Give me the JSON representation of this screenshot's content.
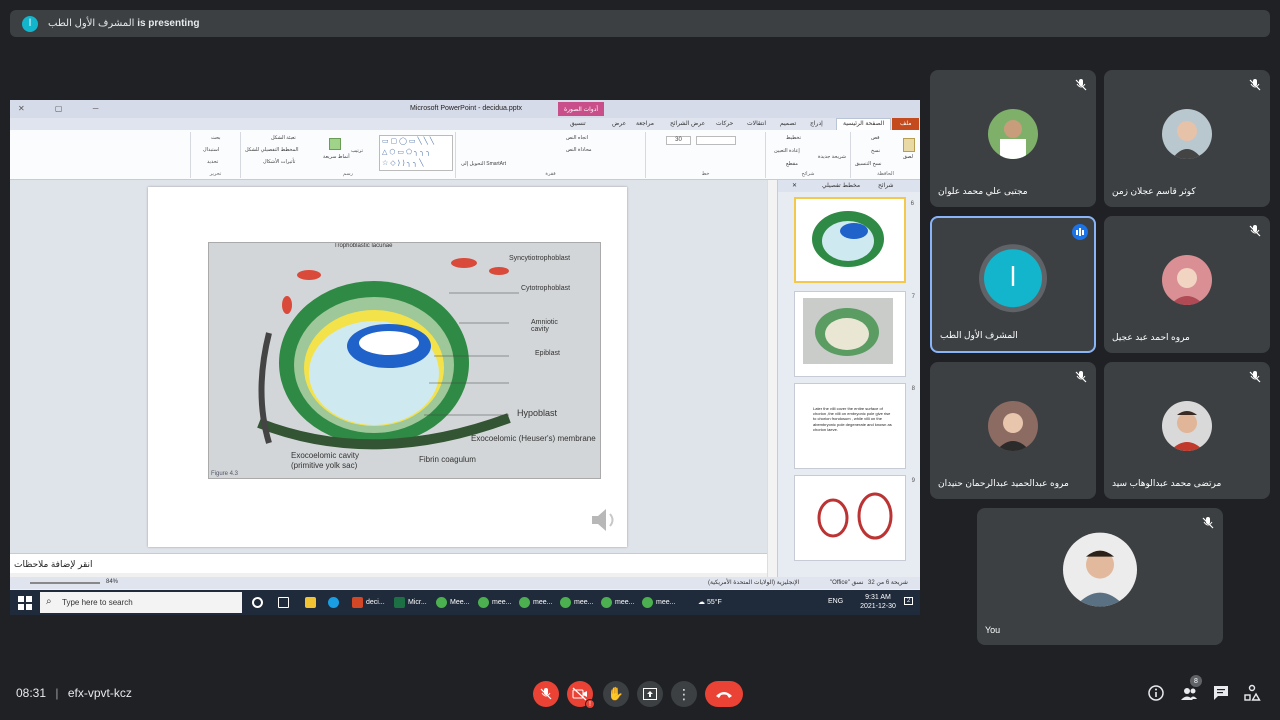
{
  "meet": {
    "presenter_name": "المشرف الأول الطب",
    "presenting_suffix": "is presenting",
    "presenter_initial": "ا",
    "time": "08:31",
    "separator": "|",
    "meeting_code": "efx-vpvt-kcz",
    "participant_badge": "8",
    "participants": [
      {
        "name": "مجتبى علي محمد علوان",
        "muted": true
      },
      {
        "name": "كوثر قاسم عجلان زمن",
        "muted": true
      },
      {
        "name": "المشرف الأول الطب",
        "muted": false,
        "speaking": true,
        "initial": "ا"
      },
      {
        "name": "مروه احمد عبد عجيل",
        "muted": true
      },
      {
        "name": "مروه عبدالحميد عبدالرحمان حنيدان",
        "muted": true
      },
      {
        "name": "مرتضى محمد عبدالوهاب سيد",
        "muted": true
      },
      {
        "name": "You",
        "muted": true
      }
    ],
    "accent": "#1a73e8",
    "danger": "#ea4335"
  },
  "powerpoint": {
    "window_title": "Microsoft PowerPoint - decidua.pptx",
    "context_tab": "أدوات الصورة",
    "tabs": [
      "ملف",
      "الصفحة الرئيسية",
      "إدراج",
      "تصميم",
      "انتقالات",
      "حركات",
      "عرض الشرائح",
      "مراجعة",
      "عرض",
      "تنسيق"
    ],
    "ribbon_groups": [
      "الحافظة",
      "شرائح",
      "خط",
      "فقرة",
      "رسم",
      "تحرير"
    ],
    "clipboard": {
      "paste": "لصق",
      "cut": "قص",
      "copy": "نسخ",
      "format_painter": "نسخ التنسيق"
    },
    "slides_group": {
      "new_slide": "شريحة جديدة",
      "layout": "تخطيط",
      "reset": "إعادة التعيين",
      "section": "مقطع"
    },
    "font_size": "30",
    "paragraph": {
      "text_direction": "اتجاه النص",
      "align_text": "محاذاة النص",
      "smartart": "التحويل إلى SmartArt"
    },
    "drawing": {
      "arrange": "ترتيب",
      "quick_styles": "أنماط سريعة",
      "shape_fill": "تعبئة الشكل",
      "shape_outline": "المخطط التفصيلي للشكل",
      "shape_effects": "تأثيرات الأشكال"
    },
    "editing": {
      "find": "بحث",
      "replace": "استبدال",
      "select": "تحديد"
    },
    "panel_tabs": {
      "slides": "شرائح",
      "outline": "مخطط تفصيلي"
    },
    "thumbnails": [
      {
        "num": "6",
        "selected": true
      },
      {
        "num": "7",
        "selected": false
      },
      {
        "num": "8",
        "selected": false,
        "text": "Later the villi cover the entire surface of chorion ,the villi on embryonic pole give rise to chorion frondosum , while villi on the abembryonic pole degenerate and known as chorion laeve."
      },
      {
        "num": "9",
        "selected": false
      }
    ],
    "notes_placeholder": "انقر لإضافة ملاحظات",
    "status": {
      "slide": "شريحة 6 من 32",
      "theme": "\"Office\" نسق",
      "language": "الإنجليزية (الولايات المتحدة الأمريكية)",
      "zoom": "84%"
    },
    "figure_labels": [
      "Trophoblastic lacunae",
      "Syncytiotrophoblast",
      "Cytotrophoblast",
      "Amniotic cavity",
      "Epiblast",
      "Hypoblast",
      "Exocoelomic (Heuser's) membrane",
      "Exocoelomic cavity (primitive yolk sac)",
      "Fibrin coagulum",
      "Figure 4.3"
    ]
  },
  "taskbar": {
    "search_placeholder": "Type here to search",
    "apps": [
      "deci...",
      "Micr...",
      "Mee...",
      "mee...",
      "mee...",
      "mee...",
      "mee...",
      "mee..."
    ],
    "weather": "55°F",
    "lang": "ENG",
    "clock_time": "9:31 AM",
    "clock_date": "2021-12-30",
    "notif_count": "2"
  }
}
